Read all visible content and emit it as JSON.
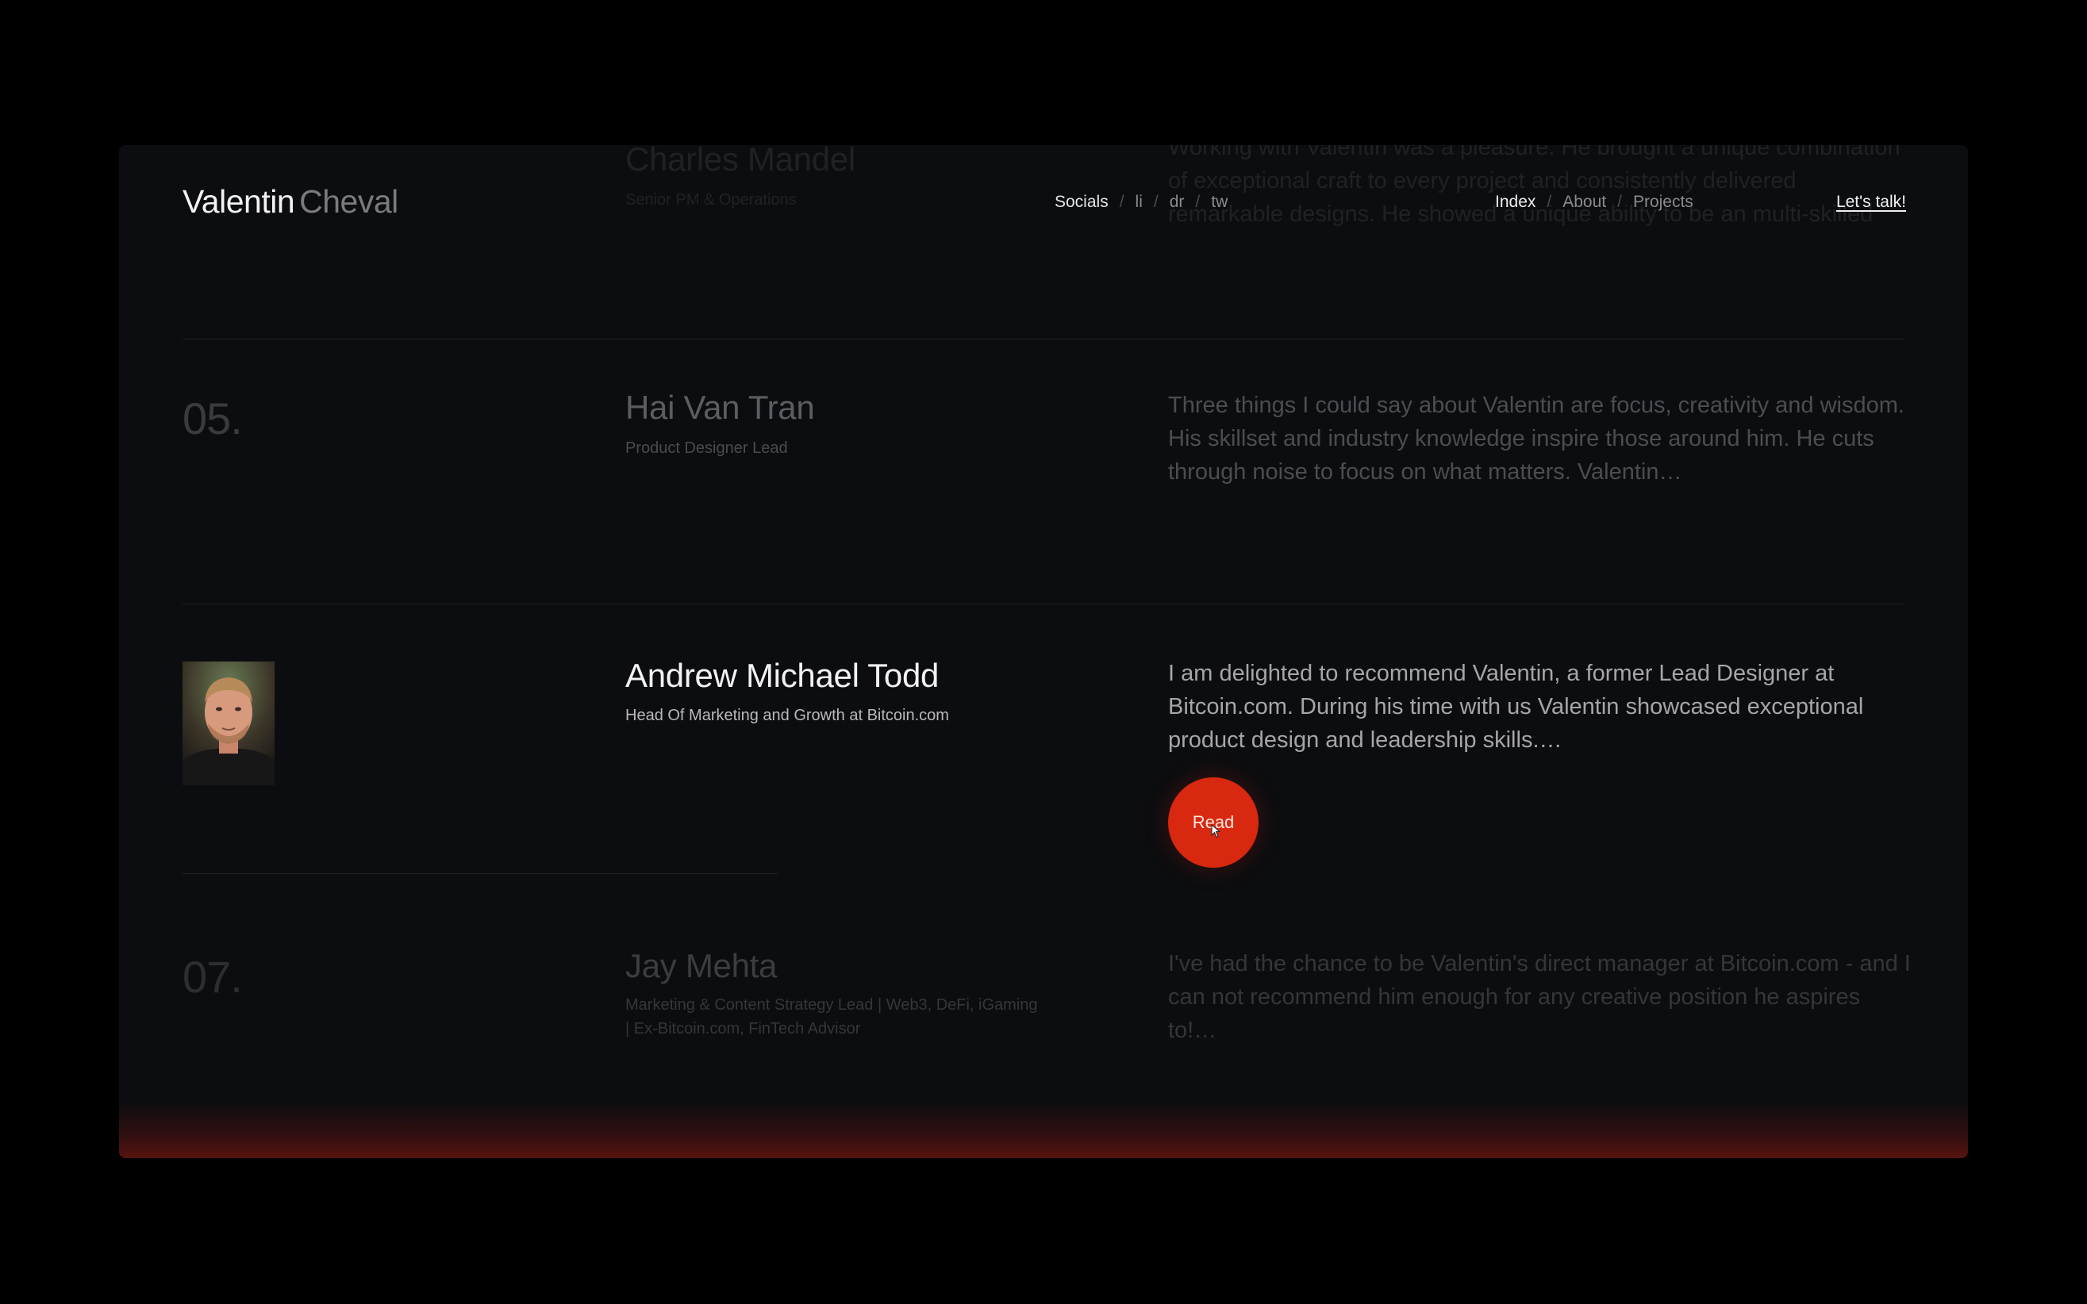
{
  "brand": {
    "first": "Valentin",
    "last": "Cheval"
  },
  "socials": {
    "label": "Socials",
    "links": [
      "li",
      "dr",
      "tw"
    ],
    "separator": "/"
  },
  "nav": {
    "items": [
      "Index",
      "About",
      "Projects"
    ],
    "active": "Index",
    "separator": "/"
  },
  "cta": "Let's talk!",
  "ghost": {
    "name": "Charles Mandel",
    "role": "Senior PM & Operations",
    "quote": "Working with Valentin was a pleasure. He brought a unique combination of exceptional craft to every project and consistently delivered remarkable designs. He showed a unique ability to be an multi-skilled"
  },
  "testimonials": [
    {
      "number": "05.",
      "name": "Hai Van Tran",
      "role": "Product Designer Lead",
      "quote": "Three things I could say about Valentin are focus, creativity and wisdom. His skillset and industry knowledge inspire those around him. He cuts through noise to focus on what matters. Valentin…"
    },
    {
      "name": "Andrew Michael Todd",
      "role": "Head Of Marketing and Growth at Bitcoin.com",
      "quote": "I am delighted to recommend Valentin, a former Lead Designer at Bitcoin.com. During his time with us Valentin showcased exceptional product design and leadership skills.…",
      "action": "Read"
    },
    {
      "number": "07.",
      "name": "Jay Mehta",
      "role": "Marketing & Content Strategy Lead | Web3, DeFi, iGaming | Ex-Bitcoin.com, FinTech Advisor",
      "quote": "I've had the chance to be Valentin's direct manager at Bitcoin.com - and I can not recommend him enough for any creative position he aspires to!…"
    }
  ],
  "colors": {
    "background": "#000000",
    "panel": "#0c0d10",
    "accent": "#d8280f"
  }
}
